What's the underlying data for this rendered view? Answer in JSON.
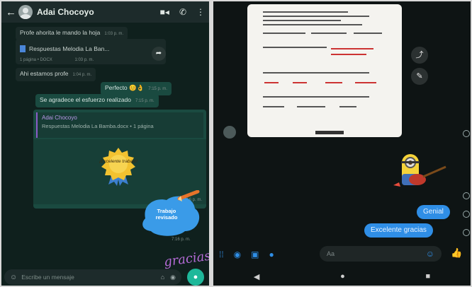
{
  "whatsapp": {
    "header": {
      "back_icon": "arrow-left-icon",
      "contact_name": "Adai Chocoyo",
      "icons": [
        "video-call-icon",
        "phone-icon",
        "more-vert-icon"
      ]
    },
    "messages": [
      {
        "kind": "in",
        "text": "Profe ahorita le mando la hoja",
        "time": "1:03 p. m."
      },
      {
        "kind": "document",
        "file_name": "Respuestas Melodia La Ban...",
        "meta": "1 página • DOCX",
        "time": "1:03 p. m."
      },
      {
        "kind": "in",
        "text": "Ahi estamos profe",
        "time": "1:04 p. m."
      },
      {
        "kind": "out",
        "text": "Perfecto 😊👌",
        "time": "7:15 p. m."
      },
      {
        "kind": "out",
        "text": "Se agradece el esfuerzo realizado",
        "time": "7:15 p. m."
      },
      {
        "kind": "quoted_sticker",
        "quote_author": "Adai Chocoyo",
        "quote_text": "Respuestas Melodia La Bamba.docx • 1 página",
        "sticker_text": "¡Excelente trabajo!",
        "time": "7:16 p. m."
      },
      {
        "kind": "sticker",
        "sticker_text": "Trabajo revisado",
        "time": "7:16 p. m."
      }
    ],
    "gracias_sticker": "gracias",
    "input": {
      "placeholder": "Escribe un mensaje",
      "icons": [
        "emoji-icon",
        "attach-icon",
        "camera-icon",
        "mic-icon"
      ]
    }
  },
  "messenger": {
    "photo_description_icon": "homework-photo",
    "side_actions": [
      "share-icon",
      "edit-icon"
    ],
    "messages": [
      {
        "kind": "sticker",
        "name": "minion-guitar-sticker"
      },
      {
        "kind": "out",
        "text": "Genial"
      },
      {
        "kind": "out",
        "text": "Excelente gracias"
      }
    ],
    "composer": {
      "placeholder": "Aa",
      "icons": [
        "apps-icon",
        "camera-icon",
        "image-icon",
        "mic-icon",
        "emoji-icon",
        "like-icon"
      ]
    },
    "nav": [
      "back-icon",
      "home-icon",
      "recents-icon"
    ]
  },
  "colors": {
    "whatsapp_bg": "#0f201d",
    "whatsapp_outgoing": "#1a4a40",
    "whatsapp_accent": "#1eb89a",
    "messenger_bg": "#0e1414",
    "messenger_accent": "#2f8ee6"
  }
}
